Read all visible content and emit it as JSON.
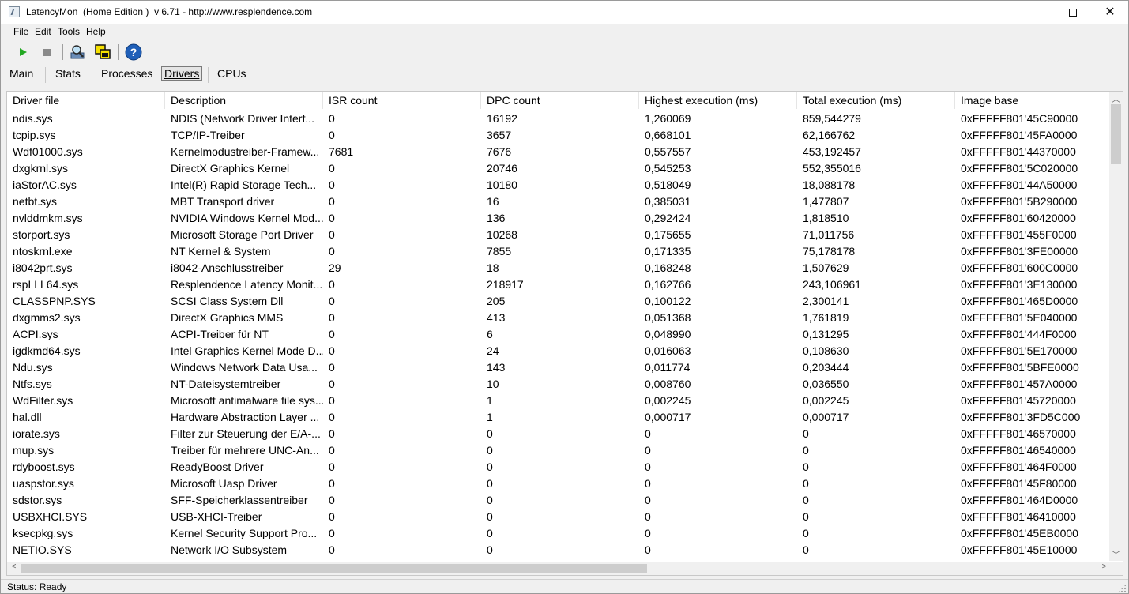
{
  "window": {
    "title": "LatencyMon  (Home Edition )  v 6.71 - http://www.resplendence.com"
  },
  "menu": [
    {
      "key": "F",
      "rest": "ile"
    },
    {
      "key": "E",
      "rest": "dit"
    },
    {
      "key": "T",
      "rest": "ools"
    },
    {
      "key": "H",
      "rest": "elp"
    }
  ],
  "toolbar": {
    "icons": [
      "play-icon",
      "stop-icon",
      "search-drivers-icon",
      "windows-icon",
      "help-icon"
    ],
    "colors": {
      "play": "#22a822",
      "stop": "#8a8a8a",
      "help": "#1f5fb8"
    }
  },
  "tabs": {
    "main": "Main",
    "stats": "Stats",
    "processes": "Processes",
    "drivers": "Drivers",
    "cpus": "CPUs"
  },
  "table": {
    "columns": [
      "Driver file",
      "Description",
      "ISR count",
      "DPC count",
      "Highest execution (ms)",
      "Total execution (ms)",
      "Image base"
    ],
    "rows": [
      [
        "ndis.sys",
        "NDIS (Network Driver Interf...",
        "0",
        "16192",
        "1,260069",
        "859,544279",
        "0xFFFFF801'45C90000"
      ],
      [
        "tcpip.sys",
        "TCP/IP-Treiber",
        "0",
        "3657",
        "0,668101",
        "62,166762",
        "0xFFFFF801'45FA0000"
      ],
      [
        "Wdf01000.sys",
        "Kernelmodustreiber-Framew...",
        "7681",
        "7676",
        "0,557557",
        "453,192457",
        "0xFFFFF801'44370000"
      ],
      [
        "dxgkrnl.sys",
        "DirectX Graphics Kernel",
        "0",
        "20746",
        "0,545253",
        "552,355016",
        "0xFFFFF801'5C020000"
      ],
      [
        "iaStorAC.sys",
        "Intel(R) Rapid Storage Tech...",
        "0",
        "10180",
        "0,518049",
        "18,088178",
        "0xFFFFF801'44A50000"
      ],
      [
        "netbt.sys",
        "MBT Transport driver",
        "0",
        "16",
        "0,385031",
        "1,477807",
        "0xFFFFF801'5B290000"
      ],
      [
        "nvlddmkm.sys",
        "NVIDIA Windows Kernel Mod...",
        "0",
        "136",
        "0,292424",
        "1,818510",
        "0xFFFFF801'60420000"
      ],
      [
        "storport.sys",
        "Microsoft Storage Port Driver",
        "0",
        "10268",
        "0,175655",
        "71,011756",
        "0xFFFFF801'455F0000"
      ],
      [
        "ntoskrnl.exe",
        "NT Kernel & System",
        "0",
        "7855",
        "0,171335",
        "75,178178",
        "0xFFFFF801'3FE00000"
      ],
      [
        "i8042prt.sys",
        "i8042-Anschlusstreiber",
        "29",
        "18",
        "0,168248",
        "1,507629",
        "0xFFFFF801'600C0000"
      ],
      [
        "rspLLL64.sys",
        "Resplendence Latency Monit...",
        "0",
        "218917",
        "0,162766",
        "243,106961",
        "0xFFFFF801'3E130000"
      ],
      [
        "CLASSPNP.SYS",
        "SCSI Class System Dll",
        "0",
        "205",
        "0,100122",
        "2,300141",
        "0xFFFFF801'465D0000"
      ],
      [
        "dxgmms2.sys",
        "DirectX Graphics MMS",
        "0",
        "413",
        "0,051368",
        "1,761819",
        "0xFFFFF801'5E040000"
      ],
      [
        "ACPI.sys",
        "ACPI-Treiber für NT",
        "0",
        "6",
        "0,048990",
        "0,131295",
        "0xFFFFF801'444F0000"
      ],
      [
        "igdkmd64.sys",
        "Intel Graphics Kernel Mode D...",
        "0",
        "24",
        "0,016063",
        "0,108630",
        "0xFFFFF801'5E170000"
      ],
      [
        "Ndu.sys",
        "Windows Network Data Usa...",
        "0",
        "143",
        "0,011774",
        "0,203444",
        "0xFFFFF801'5BFE0000"
      ],
      [
        "Ntfs.sys",
        "NT-Dateisystemtreiber",
        "0",
        "10",
        "0,008760",
        "0,036550",
        "0xFFFFF801'457A0000"
      ],
      [
        "WdFilter.sys",
        "Microsoft antimalware file sys...",
        "0",
        "1",
        "0,002245",
        "0,002245",
        "0xFFFFF801'45720000"
      ],
      [
        "hal.dll",
        "Hardware Abstraction Layer ...",
        "0",
        "1",
        "0,000717",
        "0,000717",
        "0xFFFFF801'3FD5C000"
      ],
      [
        "iorate.sys",
        "Filter zur Steuerung der E/A-...",
        "0",
        "0",
        "0",
        "0",
        "0xFFFFF801'46570000"
      ],
      [
        "mup.sys",
        "Treiber für mehrere UNC-An...",
        "0",
        "0",
        "0",
        "0",
        "0xFFFFF801'46540000"
      ],
      [
        "rdyboost.sys",
        "ReadyBoost Driver",
        "0",
        "0",
        "0",
        "0",
        "0xFFFFF801'464F0000"
      ],
      [
        "uaspstor.sys",
        "Microsoft Uasp Driver",
        "0",
        "0",
        "0",
        "0",
        "0xFFFFF801'45F80000"
      ],
      [
        "sdstor.sys",
        "SFF-Speicherklassentreiber",
        "0",
        "0",
        "0",
        "0",
        "0xFFFFF801'464D0000"
      ],
      [
        "USBXHCI.SYS",
        "USB-XHCI-Treiber",
        "0",
        "0",
        "0",
        "0",
        "0xFFFFF801'46410000"
      ],
      [
        "ksecpkg.sys",
        "Kernel Security Support Pro...",
        "0",
        "0",
        "0",
        "0",
        "0xFFFFF801'45EB0000"
      ],
      [
        "NETIO.SYS",
        "Network I/O Subsystem",
        "0",
        "0",
        "0",
        "0",
        "0xFFFFF801'45E10000"
      ]
    ]
  },
  "status": {
    "text": "Status: Ready"
  }
}
